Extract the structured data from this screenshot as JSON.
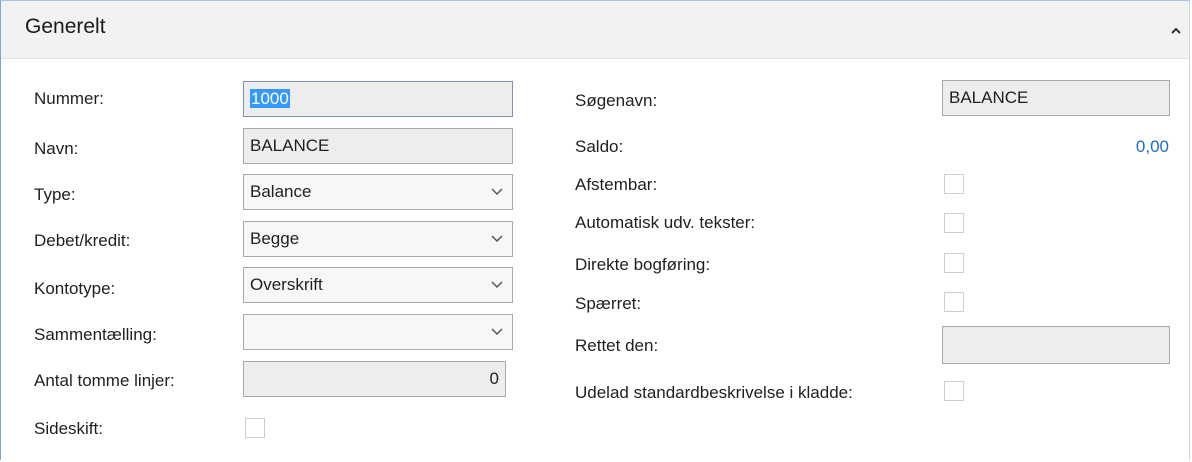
{
  "header": {
    "title": "Generelt"
  },
  "left": {
    "nummer": {
      "label": "Nummer:",
      "value": "1000"
    },
    "navn": {
      "label": "Navn:",
      "value": "BALANCE"
    },
    "type": {
      "label": "Type:",
      "value": "Balance"
    },
    "debet_kredit": {
      "label": "Debet/kredit:",
      "value": "Begge"
    },
    "kontotype": {
      "label": "Kontotype:",
      "value": "Overskrift"
    },
    "sammentaelling": {
      "label": "Sammentælling:",
      "value": ""
    },
    "antal_tomme_linjer": {
      "label": "Antal tomme linjer:",
      "value": "0"
    },
    "sideskift": {
      "label": "Sideskift:",
      "checked": false
    }
  },
  "right": {
    "soegenavn": {
      "label": "Søgenavn:",
      "value": "BALANCE"
    },
    "saldo": {
      "label": "Saldo:",
      "value": "0,00"
    },
    "afstembar": {
      "label": "Afstembar:",
      "checked": false
    },
    "automatisk_udv_tekster": {
      "label": "Automatisk udv. tekster:",
      "checked": false
    },
    "direkte_bogfoering": {
      "label": "Direkte bogføring:",
      "checked": false
    },
    "spaerret": {
      "label": "Spærret:",
      "checked": false
    },
    "rettet_den": {
      "label": "Rettet den:",
      "value": ""
    },
    "udelad_standardbeskrivelse": {
      "label": "Udelad standardbeskrivelse i kladde:",
      "checked": false
    }
  },
  "icons": {
    "collapse": "chevron-up-icon",
    "dropdown": "chevron-down-icon"
  },
  "colors": {
    "accent": "#1a6fcf",
    "selection": "#3399ff",
    "header_bg": "#f2f2f2"
  }
}
